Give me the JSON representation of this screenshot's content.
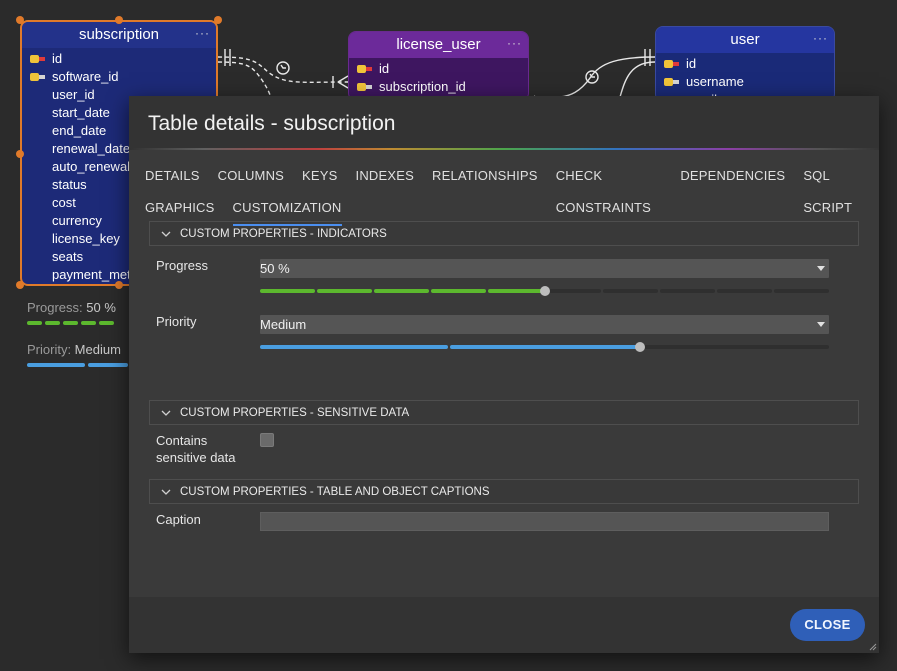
{
  "diagram": {
    "subscription": {
      "title": "subscription",
      "menu": "···",
      "fields": [
        {
          "name": "id",
          "key": "pk"
        },
        {
          "name": "software_id",
          "key": "fk"
        },
        {
          "name": "user_id",
          "key": ""
        },
        {
          "name": "start_date",
          "key": ""
        },
        {
          "name": "end_date",
          "key": ""
        },
        {
          "name": "renewal_date",
          "key": ""
        },
        {
          "name": "auto_renewal",
          "key": ""
        },
        {
          "name": "status",
          "key": ""
        },
        {
          "name": "cost",
          "key": ""
        },
        {
          "name": "currency",
          "key": ""
        },
        {
          "name": "license_key",
          "key": ""
        },
        {
          "name": "seats",
          "key": ""
        },
        {
          "name": "payment_met",
          "key": ""
        }
      ]
    },
    "license_user": {
      "title": "license_user",
      "menu": "···",
      "fields": [
        {
          "name": "id",
          "key": "pk"
        },
        {
          "name": "subscription_id",
          "key": "fk"
        }
      ]
    },
    "user": {
      "title": "user",
      "menu": "···",
      "fields": [
        {
          "name": "id",
          "key": "pk"
        },
        {
          "name": "username",
          "key": "fk"
        },
        {
          "name": "email",
          "key": "fk"
        }
      ]
    },
    "indicators": {
      "progress_label": "Progress: ",
      "progress_value": "50 %",
      "priority_label": "Priority: ",
      "priority_value": "Medium"
    }
  },
  "dialog": {
    "title": "Table details - subscription",
    "tabs_row1": [
      "DETAILS",
      "COLUMNS",
      "KEYS",
      "INDEXES",
      "RELATIONSHIPS",
      "CHECK CONSTRAINTS",
      "DEPENDENCIES",
      "SQL SCRIPT"
    ],
    "tabs_row2": [
      "GRAPHICS",
      "CUSTOMIZATION"
    ],
    "active_tab": "CUSTOMIZATION",
    "sections": {
      "indicators": "CUSTOM PROPERTIES - INDICATORS",
      "sensitive": "CUSTOM PROPERTIES - SENSITIVE DATA",
      "captions": "CUSTOM PROPERTIES - TABLE AND OBJECT CAPTIONS"
    },
    "progress": {
      "label": "Progress",
      "value": "50 %",
      "level": 0.5,
      "steps": 10,
      "color": "#5cb82e"
    },
    "priority": {
      "label": "Priority",
      "value": "Medium",
      "level": 0.667,
      "steps": 3,
      "color": "#4a9ee0"
    },
    "sensitive": {
      "label_line1": "Contains",
      "label_line2": "sensitive data",
      "checked": false
    },
    "caption": {
      "label": "Caption",
      "value": ""
    },
    "close_label": "CLOSE"
  },
  "colors": {
    "accent": "#4a8ef0",
    "close_button": "#2f5fb8",
    "selection_border": "#e07a2a",
    "track": "#2f2f2f"
  }
}
